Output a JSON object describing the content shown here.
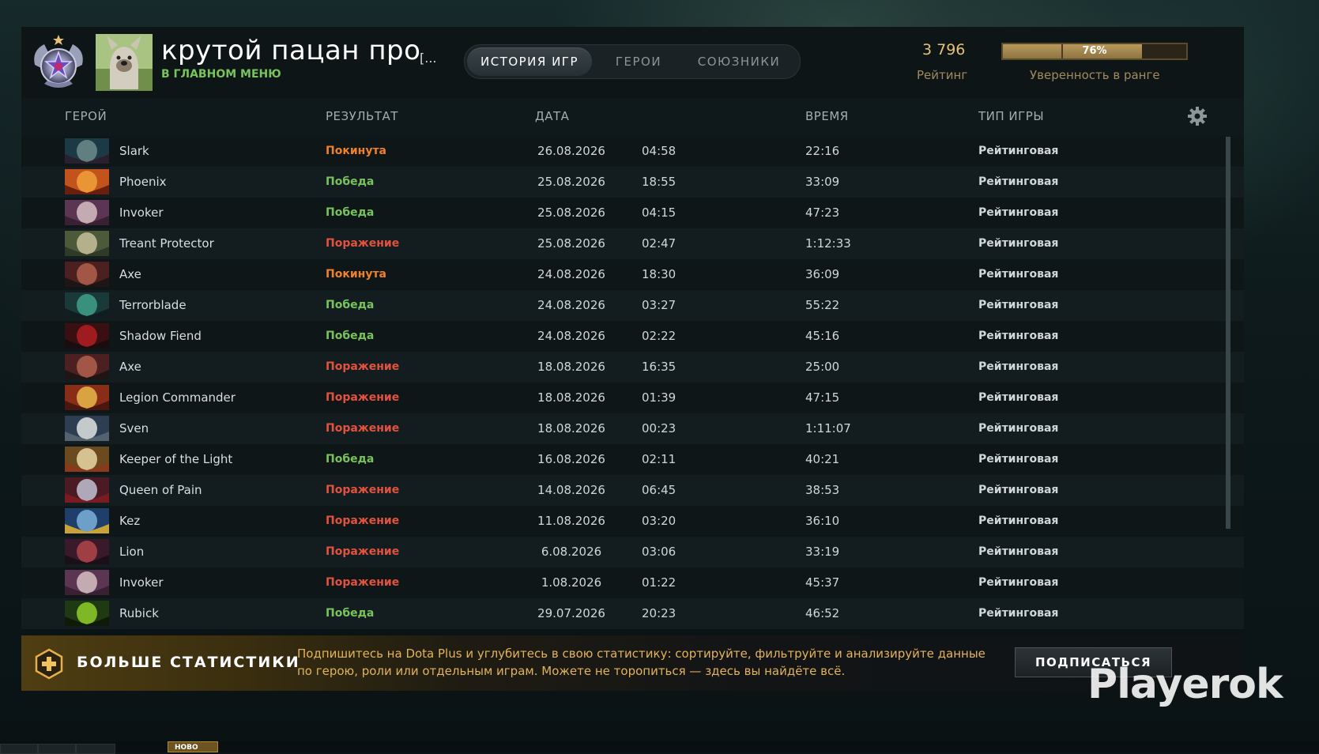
{
  "header": {
    "player_name": "крутой пацан про",
    "player_name_more": "[...",
    "status": "В ГЛАВНОМ МЕНЮ",
    "tabs": [
      {
        "label": "ИСТОРИЯ ИГР",
        "active": true
      },
      {
        "label": "ГЕРОИ",
        "active": false
      },
      {
        "label": "СОЮЗНИКИ",
        "active": false
      }
    ],
    "rating_value": "3 796",
    "rating_label": "Рейтинг",
    "confidence_value": "76%",
    "confidence_fraction": 0.76,
    "confidence_label": "Уверенность в ранге"
  },
  "table": {
    "columns": {
      "hero": "ГЕРОЙ",
      "result": "РЕЗУЛЬТАТ",
      "date": "ДАТА",
      "duration": "ВРЕМЯ",
      "game_type": "ТИП ИГРЫ"
    },
    "rows": [
      {
        "hero": "Slark",
        "result": "Покинута",
        "result_kind": "abandon",
        "date": "26.08.2026",
        "time": "04:58",
        "duration": "22:16",
        "type": "Рейтинговая",
        "icon_colors": [
          "#1c3a46",
          "#6d8b8c",
          "#2a1f2e"
        ]
      },
      {
        "hero": "Phoenix",
        "result": "Победа",
        "result_kind": "win",
        "date": "25.08.2026",
        "time": "18:55",
        "duration": "33:09",
        "type": "Рейтинговая",
        "icon_colors": [
          "#c2531c",
          "#f0a13a",
          "#6a1e0e"
        ]
      },
      {
        "hero": "Invoker",
        "result": "Победа",
        "result_kind": "win",
        "date": "25.08.2026",
        "time": "04:15",
        "duration": "47:23",
        "type": "Рейтинговая",
        "icon_colors": [
          "#5b3552",
          "#d6c0c2",
          "#3a2033"
        ]
      },
      {
        "hero": "Treant Protector",
        "result": "Поражение",
        "result_kind": "loss",
        "date": "25.08.2026",
        "time": "02:47",
        "duration": "1:12:33",
        "type": "Рейтинговая",
        "icon_colors": [
          "#4d5a3a",
          "#c6c09a",
          "#2f3a27"
        ]
      },
      {
        "hero": "Axe",
        "result": "Покинута",
        "result_kind": "abandon",
        "date": "24.08.2026",
        "time": "18:30",
        "duration": "36:09",
        "type": "Рейтинговая",
        "icon_colors": [
          "#4c2020",
          "#b1624e",
          "#201515"
        ]
      },
      {
        "hero": "Terrorblade",
        "result": "Победа",
        "result_kind": "win",
        "date": "24.08.2026",
        "time": "03:27",
        "duration": "55:22",
        "type": "Рейтинговая",
        "icon_colors": [
          "#1a3a3a",
          "#3fa08a",
          "#101e20"
        ]
      },
      {
        "hero": "Shadow Fiend",
        "result": "Победа",
        "result_kind": "win",
        "date": "24.08.2026",
        "time": "02:22",
        "duration": "45:16",
        "type": "Рейтинговая",
        "icon_colors": [
          "#3a0f12",
          "#b01f22",
          "#1a0c0f"
        ]
      },
      {
        "hero": "Axe",
        "result": "Поражение",
        "result_kind": "loss",
        "date": "18.08.2026",
        "time": "16:35",
        "duration": "25:00",
        "type": "Рейтинговая",
        "icon_colors": [
          "#4c2020",
          "#b1624e",
          "#201515"
        ]
      },
      {
        "hero": "Legion Commander",
        "result": "Поражение",
        "result_kind": "loss",
        "date": "18.08.2026",
        "time": "01:39",
        "duration": "47:15",
        "type": "Рейтинговая",
        "icon_colors": [
          "#8a2d18",
          "#e7b84a",
          "#4a1710"
        ]
      },
      {
        "hero": "Sven",
        "result": "Поражение",
        "result_kind": "loss",
        "date": "18.08.2026",
        "time": "00:23",
        "duration": "1:11:07",
        "type": "Рейтинговая",
        "icon_colors": [
          "#2d3e52",
          "#dfe3e2",
          "#526270"
        ]
      },
      {
        "hero": "Keeper of the Light",
        "result": "Победа",
        "result_kind": "win",
        "date": "16.08.2026",
        "time": "02:11",
        "duration": "40:21",
        "type": "Рейтинговая",
        "icon_colors": [
          "#6a4a1e",
          "#e9d6a4",
          "#8a3a1a"
        ]
      },
      {
        "hero": "Queen of Pain",
        "result": "Поражение",
        "result_kind": "loss",
        "date": "14.08.2026",
        "time": "06:45",
        "duration": "38:53",
        "type": "Рейтинговая",
        "icon_colors": [
          "#4b1a22",
          "#bfc2d2",
          "#7a1b22"
        ]
      },
      {
        "hero": "Kez",
        "result": "Поражение",
        "result_kind": "loss",
        "date": "11.08.2026",
        "time": "03:20",
        "duration": "36:10",
        "type": "Рейтинговая",
        "icon_colors": [
          "#1d3f6a",
          "#7ab1d8",
          "#c9a23a"
        ]
      },
      {
        "hero": "Lion",
        "result": "Поражение",
        "result_kind": "loss",
        "date": "6.08.2026",
        "time": "03:06",
        "duration": "33:19",
        "type": "Рейтинговая",
        "icon_colors": [
          "#3a1a2a",
          "#b3454a",
          "#1c1018"
        ]
      },
      {
        "hero": "Invoker",
        "result": "Поражение",
        "result_kind": "loss",
        "date": "1.08.2026",
        "time": "01:22",
        "duration": "45:37",
        "type": "Рейтинговая",
        "icon_colors": [
          "#5b3552",
          "#d6c0c2",
          "#3a2033"
        ]
      },
      {
        "hero": "Rubick",
        "result": "Победа",
        "result_kind": "win",
        "date": "29.07.2026",
        "time": "20:23",
        "duration": "46:52",
        "type": "Рейтинговая",
        "icon_colors": [
          "#1f3a12",
          "#8fcf2a",
          "#0f1a08"
        ]
      }
    ]
  },
  "promo": {
    "title": "БОЛЬШЕ СТАТИСТИКИ",
    "text": "Подпишитесь на Dota Plus и углубитесь в свою статистику: сортируйте, фильтруйте и анализируйте данные по герою, роли или отдельным играм. Можете не торопиться — здесь вы найдёте всё.",
    "button_label": "ПОДПИСАТЬСЯ"
  },
  "watermark": "Playerok",
  "bottom": {
    "new_badge": "НОВО"
  },
  "colors": {
    "win": "#78c35c",
    "loss": "#e2523d",
    "abandon": "#f0802a",
    "accent_gold": "#e7c176"
  },
  "icons": {
    "settings": "gear-icon",
    "rank_medal": "rank-medal-icon",
    "dota_plus": "dota-plus-icon"
  }
}
